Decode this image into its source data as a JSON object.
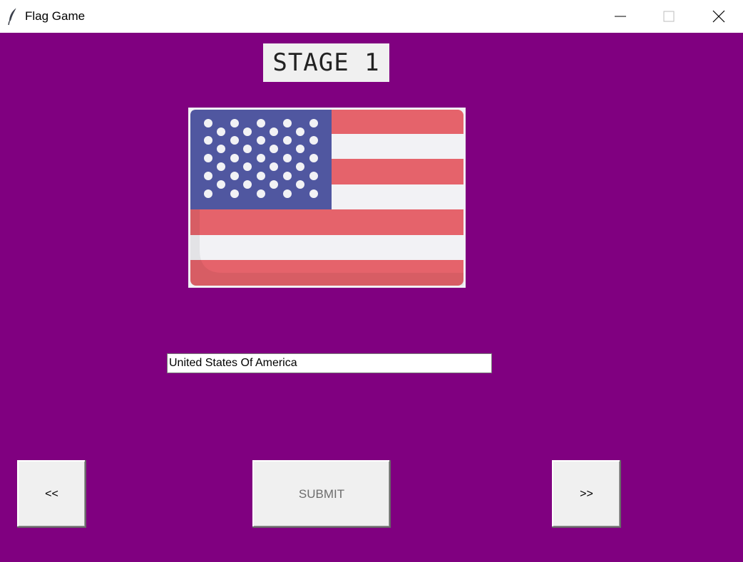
{
  "window": {
    "title": "Flag Game",
    "app_icon": "feather-icon",
    "controls": [
      "minimize-icon",
      "maximize-icon",
      "close-icon"
    ]
  },
  "stage": {
    "label": "STAGE 1"
  },
  "flag": {
    "icon": "usa-flag-image",
    "colors": {
      "red": "#e5636b",
      "white": "#f2f2f5",
      "blue": "#5057a0"
    }
  },
  "answer": {
    "value": "United States Of America",
    "placeholder": ""
  },
  "buttons": {
    "prev_label": "<<",
    "submit_label": "SUBMIT",
    "next_label": ">>"
  },
  "colors": {
    "background": "#800080",
    "button_face": "#f0f0f0"
  }
}
